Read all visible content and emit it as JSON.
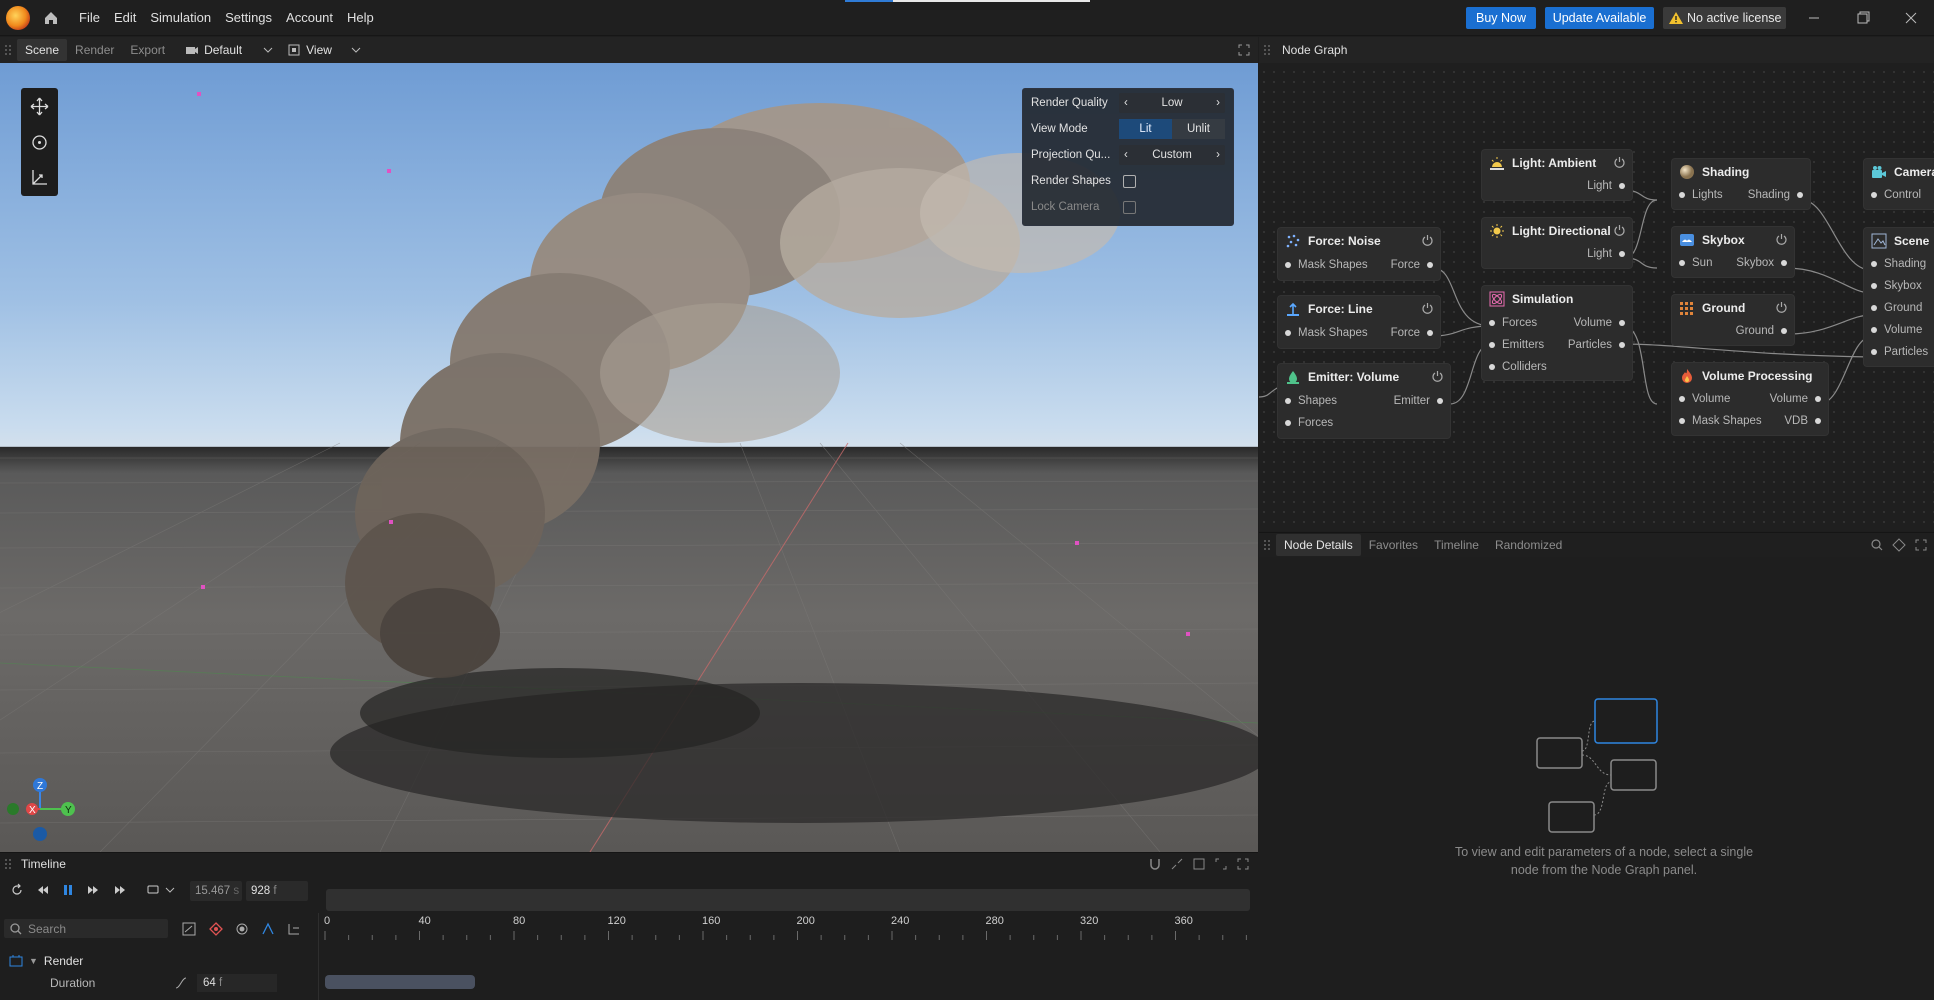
{
  "app": {
    "menu": [
      "File",
      "Edit",
      "Simulation",
      "Settings",
      "Account",
      "Help"
    ],
    "buy_now": "Buy Now",
    "update": "Update Available",
    "license": "No active license"
  },
  "viewport": {
    "tabs": [
      "Scene",
      "Render",
      "Export"
    ],
    "active_tab": "Scene",
    "layout_dropdown": "Default",
    "view_dropdown": "View",
    "overlay": {
      "render_quality_label": "Render Quality",
      "render_quality_value": "Low",
      "view_mode_label": "View Mode",
      "view_mode_options": [
        "Lit",
        "Unlit"
      ],
      "view_mode_selected": "Lit",
      "projection_label": "Projection Qu...",
      "projection_value": "Custom",
      "render_shapes_label": "Render Shapes",
      "render_shapes_checked": false,
      "lock_camera_label": "Lock Camera",
      "lock_camera_checked": false
    },
    "gizmo": {
      "z": "Z",
      "x": "X",
      "y": "Y"
    }
  },
  "timeline": {
    "title": "Timeline",
    "time_seconds": "15.467",
    "time_seconds_unit": "s",
    "frame": "928",
    "frame_unit": "f",
    "search_placeholder": "Search",
    "ruler_ticks": [
      "0",
      "40",
      "80",
      "120",
      "160",
      "200",
      "240",
      "280",
      "320",
      "360"
    ],
    "group": "Render",
    "duration_label": "Duration",
    "duration_value": "64",
    "duration_unit": "f"
  },
  "node_graph": {
    "title": "Node Graph",
    "nodes": {
      "force_noise": {
        "title": "Force: Noise",
        "in": "Mask Shapes",
        "out": "Force"
      },
      "force_line": {
        "title": "Force: Line",
        "in": "Mask Shapes",
        "out": "Force"
      },
      "emitter_volume": {
        "title": "Emitter: Volume",
        "in1": "Shapes",
        "out": "Emitter",
        "in2": "Forces"
      },
      "light_ambient": {
        "title": "Light: Ambient",
        "out": "Light"
      },
      "light_directional": {
        "title": "Light: Directional",
        "out": "Light"
      },
      "simulation": {
        "title": "Simulation",
        "in1": "Forces",
        "out1": "Volume",
        "in2": "Emitters",
        "out2": "Particles",
        "in3": "Colliders"
      },
      "shading": {
        "title": "Shading",
        "in": "Lights",
        "out": "Shading"
      },
      "skybox": {
        "title": "Skybox",
        "in": "Sun",
        "out": "Skybox"
      },
      "ground": {
        "title": "Ground",
        "out": "Ground"
      },
      "volume_processing": {
        "title": "Volume Processing",
        "in1": "Volume",
        "out1": "Volume",
        "in2": "Mask Shapes",
        "out2": "VDB"
      },
      "camera": {
        "title": "Camera",
        "in": "Control"
      },
      "scene": {
        "title": "Scene",
        "in1": "Shading",
        "in2": "Skybox",
        "in3": "Ground",
        "in4": "Volume",
        "in5": "Particles"
      }
    }
  },
  "node_details": {
    "tabs": [
      "Node Details",
      "Favorites",
      "Timeline",
      "Randomized"
    ],
    "active_tab": "Node Details",
    "empty_line1": "To view and edit parameters of a node, select a single",
    "empty_line2": "node from the Node Graph panel."
  },
  "colors": {
    "accent": "#1a6fd1",
    "panel": "#1e1e1e",
    "node": "#2c2c2c",
    "warning": "#f2c12e"
  }
}
